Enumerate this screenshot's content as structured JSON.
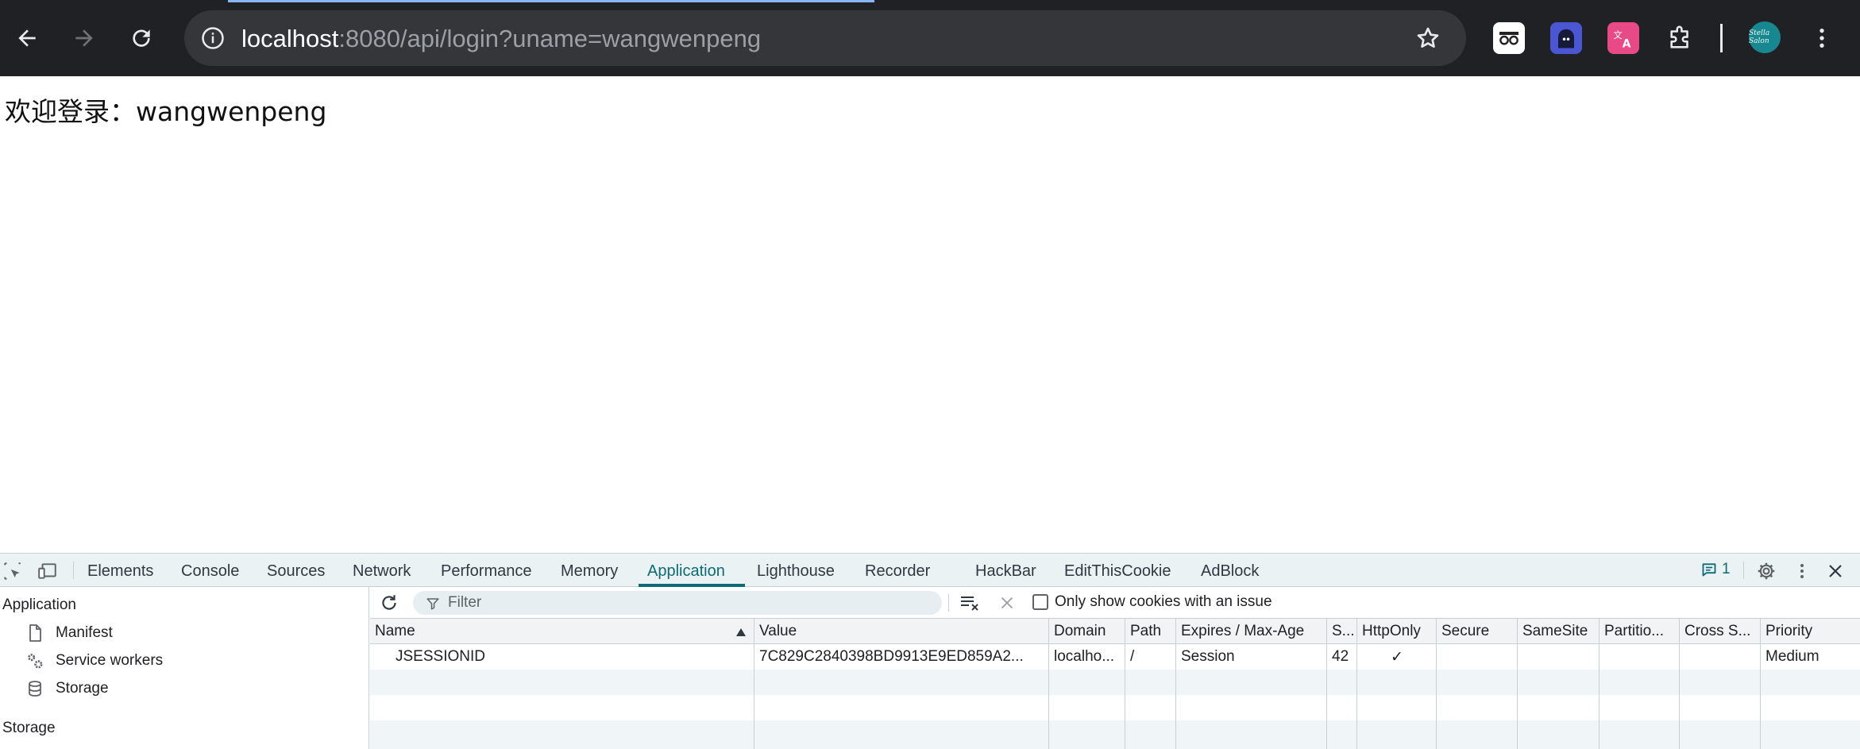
{
  "browser": {
    "url_host": "localhost",
    "url_rest": ":8080/api/login?uname=wangwenpeng",
    "avatar_text": "Stella Salon"
  },
  "page": {
    "welcome_text": "欢迎登录：wangwenpeng"
  },
  "devtools": {
    "tabs": [
      {
        "label": "Elements"
      },
      {
        "label": "Console"
      },
      {
        "label": "Sources"
      },
      {
        "label": "Network"
      },
      {
        "label": "Performance"
      },
      {
        "label": "Memory"
      },
      {
        "label": "Application"
      },
      {
        "label": "Lighthouse"
      },
      {
        "label": "Recorder"
      },
      {
        "label": "HackBar"
      },
      {
        "label": "EditThisCookie"
      },
      {
        "label": "AdBlock"
      }
    ],
    "active_tab": "Application",
    "issues_count": "1",
    "accent_color": "#0b6b78",
    "sidebar": {
      "application_heading": "Application",
      "items": [
        {
          "label": "Manifest",
          "icon": "document-icon"
        },
        {
          "label": "Service workers",
          "icon": "gears-icon"
        },
        {
          "label": "Storage",
          "icon": "database-icon"
        }
      ],
      "storage_heading": "Storage"
    },
    "cookies": {
      "filter_placeholder": "Filter",
      "only_issues_label": "Only show cookies with an issue",
      "only_issues_checked": false,
      "columns": [
        "Name",
        "Value",
        "Domain",
        "Path",
        "Expires / Max-Age",
        "S...",
        "HttpOnly",
        "Secure",
        "SameSite",
        "Partitio...",
        "Cross S...",
        "Priority"
      ],
      "rows": [
        {
          "name": "JSESSIONID",
          "value": "7C829C2840398BD9913E9ED859A2...",
          "domain": "localho...",
          "path": "/",
          "expires": "Session",
          "size": "42",
          "httponly": "✓",
          "secure": "",
          "samesite": "",
          "partition": "",
          "cross_site": "",
          "priority": "Medium"
        }
      ]
    }
  }
}
